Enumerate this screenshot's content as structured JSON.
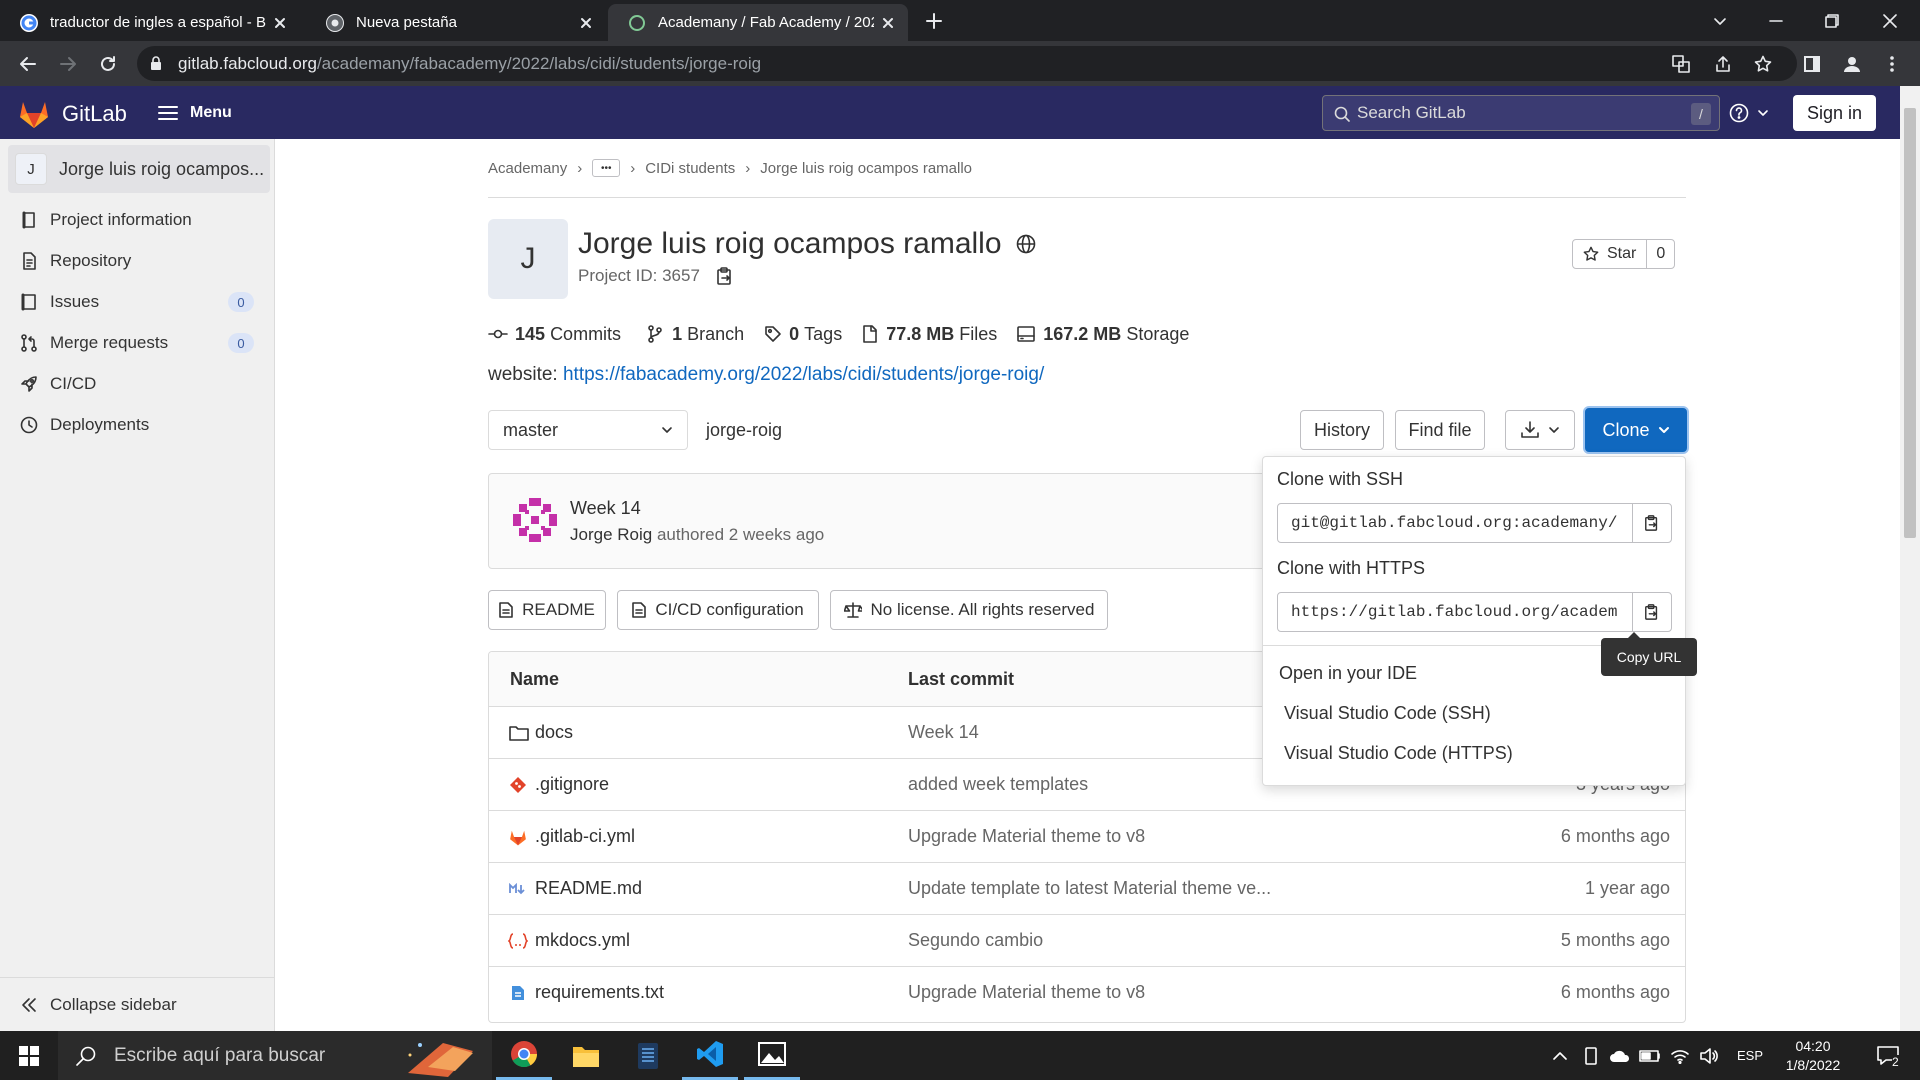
{
  "browser": {
    "tabs": [
      {
        "title": "traductor de ingles a español - B",
        "icon": "google-icon"
      },
      {
        "title": "Nueva pestaña",
        "icon": "chrome-icon"
      },
      {
        "title": "Academany / Fab Academy / 202",
        "icon": "gitlab-icon"
      }
    ],
    "url_host": "gitlab.fabcloud.org",
    "url_path": "/academany/fabacademy/2022/labs/cidi/students/jorge-roig"
  },
  "header": {
    "brand": "GitLab",
    "menu_label": "Menu",
    "search_placeholder": "Search GitLab",
    "search_shortcut": "/",
    "sign_in": "Sign in"
  },
  "sidebar": {
    "project_initial": "J",
    "project_name": "Jorge luis roig ocampos...",
    "items": [
      {
        "label": "Project information",
        "icon": "info-icon"
      },
      {
        "label": "Repository",
        "icon": "doc-icon"
      },
      {
        "label": "Issues",
        "icon": "issues-icon",
        "count": "0"
      },
      {
        "label": "Merge requests",
        "icon": "merge-icon",
        "count": "0"
      },
      {
        "label": "CI/CD",
        "icon": "rocket-icon"
      },
      {
        "label": "Deployments",
        "icon": "deploy-icon"
      }
    ],
    "collapse": "Collapse sidebar"
  },
  "breadcrumb": {
    "items": [
      "Academany",
      "CIDi students",
      "Jorge luis roig ocampos ramallo"
    ],
    "ellipsis": "•••"
  },
  "project": {
    "initial": "J",
    "title": "Jorge luis roig ocampos ramallo",
    "project_id": "Project ID: 3657",
    "star_label": "Star",
    "star_count": "0",
    "stats": [
      {
        "value": "145",
        "label": "Commits"
      },
      {
        "value": "1",
        "label": "Branch"
      },
      {
        "value": "0",
        "label": "Tags"
      },
      {
        "value": "77.8 MB",
        "label": "Files"
      },
      {
        "value": "167.2 MB",
        "label": "Storage"
      }
    ],
    "website_label": "website:",
    "website_url": "https://fabacademy.org/2022/labs/cidi/students/jorge-roig/"
  },
  "toolbar": {
    "branch": "master",
    "path": "jorge-roig",
    "history": "History",
    "find_file": "Find file",
    "clone": "Clone"
  },
  "commit": {
    "title": "Week 14",
    "author": "Jorge Roig",
    "meta": "authored 2 weeks ago"
  },
  "badges": [
    "README",
    "CI/CD configuration",
    "No license. All rights reserved"
  ],
  "files": {
    "col_name": "Name",
    "col_commit": "Last commit",
    "rows": [
      {
        "name": "docs",
        "commit": "Week 14",
        "time": "",
        "icon": "folder-icon"
      },
      {
        "name": ".gitignore",
        "commit": "added week templates",
        "time": "3 years ago",
        "icon": "git-icon"
      },
      {
        "name": ".gitlab-ci.yml",
        "commit": "Upgrade Material theme to v8",
        "time": "6 months ago",
        "icon": "gitlab-icon"
      },
      {
        "name": "README.md",
        "commit": "Update template to latest Material theme ve...",
        "time": "1 year ago",
        "icon": "markdown-icon"
      },
      {
        "name": "mkdocs.yml",
        "commit": "Segundo cambio",
        "time": "5 months ago",
        "icon": "yaml-icon"
      },
      {
        "name": "requirements.txt",
        "commit": "Upgrade Material theme to v8",
        "time": "6 months ago",
        "icon": "file-icon"
      }
    ]
  },
  "clone_dropdown": {
    "ssh_label": "Clone with SSH",
    "ssh_url": "git@gitlab.fabcloud.org:academany/",
    "https_label": "Clone with HTTPS",
    "https_url": "https://gitlab.fabcloud.org/academ",
    "tooltip": "Copy URL",
    "ide_label": "Open in your IDE",
    "ide_items": [
      "Visual Studio Code (SSH)",
      "Visual Studio Code (HTTPS)"
    ]
  },
  "taskbar": {
    "search_placeholder": "Escribe aquí para buscar",
    "lang": "ESP",
    "time": "04:20",
    "date": "1/8/2022",
    "notifications": "2"
  },
  "colors": {
    "gitlab_header": "#292961",
    "accent": "#1068bf",
    "sidebar": "#f0f0f0"
  }
}
